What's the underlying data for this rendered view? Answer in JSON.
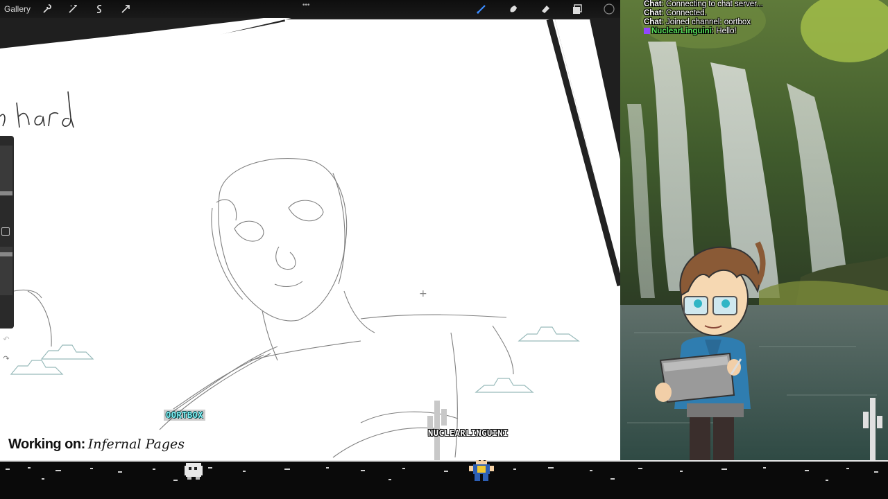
{
  "toolbar": {
    "gallery_label": "Gallery",
    "left_tools": [
      "wrench-icon",
      "magic-wand-icon",
      "selection-icon",
      "transform-arrow-icon"
    ],
    "more_label": "•••",
    "right_tools": [
      "brush-icon",
      "smudge-icon",
      "eraser-icon",
      "layers-icon",
      "color-swatch-icon"
    ],
    "active_tool": "brush",
    "accent_color": "#3a8bff"
  },
  "canvas": {
    "handwriting_text": "hard"
  },
  "side_panel": {
    "undo_label": "↶",
    "redo_label": "↷"
  },
  "chat": {
    "lines": [
      {
        "prefix": "Chat",
        "text": ": Connecting to chat server..."
      },
      {
        "prefix": "Chat",
        "text": ": Connected."
      },
      {
        "prefix": "Chat",
        "text": ": Joined channel: oortbox"
      }
    ],
    "message": {
      "user": "NuclearLinguini",
      "text": ": Hello!",
      "user_color": "#58e05a",
      "badge_color": "#9146ff"
    }
  },
  "overlay": {
    "working_on_label": "Working on:",
    "project_name": "Infernal Pages",
    "streamer_tag": "OORTBOX",
    "viewer_tag": "NUCLEARLINGUINI"
  },
  "colors": {
    "canvas_bg": "#ffffff",
    "frame_dark": "#1c1c1c",
    "tag_cyan": "#7ef3f7"
  }
}
